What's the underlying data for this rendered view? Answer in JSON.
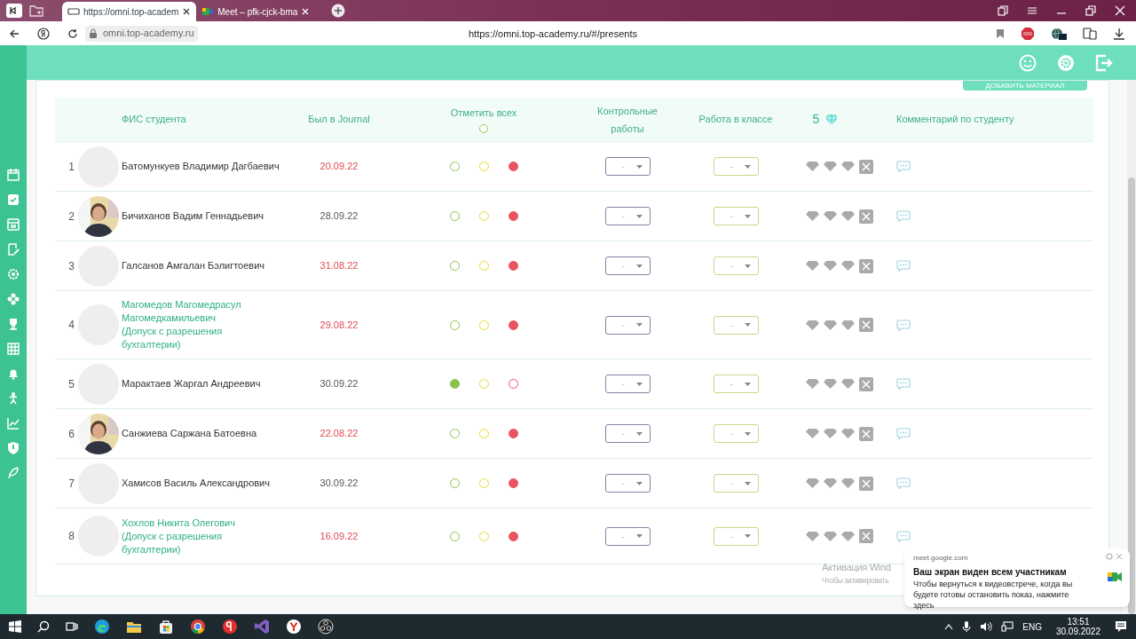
{
  "browser": {
    "tabs": [
      {
        "title": "https://omni.top-academ",
        "selected": true,
        "kind": "page"
      },
      {
        "title": "Meet – pfk-cjck-bma",
        "selected": false,
        "kind": "meet"
      }
    ],
    "address_domain": "omni.top-academy.ru",
    "page_url": "https://omni.top-academy.ru/#/presents"
  },
  "add_material_button": "ДОБАВИТЬ МАТЕРИАЛ",
  "table": {
    "columns": {
      "name": "ФИС студента",
      "last_visit": "Был в Journal",
      "mark_all": "Отметить всех",
      "mark_all_checked": false,
      "tests": "Контрольные работы",
      "class_work": "Работа в классе",
      "gems": "5",
      "comment": "Комментарий по студенту"
    },
    "rows": [
      {
        "number": "1",
        "name": "Батомункуев Владимир Дагбаевич",
        "has_photo": false,
        "name_highlighted": false,
        "last_visit": "20.09.22",
        "overdue": true,
        "present": false,
        "late": false,
        "absent": true,
        "test_grade": "-",
        "class_grade": "-"
      },
      {
        "number": "2",
        "name": "Бичиханов Вадим Геннадьевич",
        "has_photo": true,
        "name_highlighted": false,
        "last_visit": "28.09.22",
        "overdue": false,
        "present": false,
        "late": false,
        "absent": true,
        "test_grade": "-",
        "class_grade": "-"
      },
      {
        "number": "3",
        "name": "Галсанов Амгалан Бэлигтоевич",
        "has_photo": false,
        "name_highlighted": false,
        "last_visit": "31.08.22",
        "overdue": true,
        "present": false,
        "late": false,
        "absent": true,
        "test_grade": "-",
        "class_grade": "-"
      },
      {
        "number": "4",
        "name": "Магомедов Магомедрасул Магомедкамильевич (Допуск с разрешения бухгалтерии)",
        "has_photo": false,
        "name_highlighted": true,
        "last_visit": "29.08.22",
        "overdue": true,
        "present": false,
        "late": false,
        "absent": true,
        "test_grade": "-",
        "class_grade": "-"
      },
      {
        "number": "5",
        "name": "Марактаев Жаргал Андреевич",
        "has_photo": false,
        "name_highlighted": false,
        "last_visit": "30.09.22",
        "overdue": false,
        "present": true,
        "late": false,
        "absent": false,
        "test_grade": "-",
        "class_grade": "-"
      },
      {
        "number": "6",
        "name": "Санжиева Саржана Батоевна",
        "has_photo": true,
        "name_highlighted": false,
        "last_visit": "22.08.22",
        "overdue": true,
        "present": false,
        "late": false,
        "absent": true,
        "test_grade": "-",
        "class_grade": "-"
      },
      {
        "number": "7",
        "name": "Хамисов Василь Александрович",
        "has_photo": false,
        "name_highlighted": false,
        "last_visit": "30.09.22",
        "overdue": false,
        "present": false,
        "late": false,
        "absent": true,
        "test_grade": "-",
        "class_grade": "-"
      },
      {
        "number": "8",
        "name": "Хохлов Никита Олегович (Допуск с разрешения бухгалтерии)",
        "has_photo": false,
        "name_highlighted": true,
        "last_visit": "16.09.22",
        "overdue": true,
        "present": false,
        "late": false,
        "absent": true,
        "test_grade": "-",
        "class_grade": "-"
      }
    ]
  },
  "windows_activation": {
    "title": "Активация Wind",
    "subtitle": "Чтобы активировать"
  },
  "notification": {
    "source": "meet.google.com",
    "title": "Ваш экран виден всем участникам",
    "body": "Чтобы вернуться к видеовстрече, когда вы будете готовы остановить показ, нажмите здесь"
  },
  "taskbar": {
    "language": "ENG",
    "time": "13:51",
    "date": "30.09.2022"
  }
}
